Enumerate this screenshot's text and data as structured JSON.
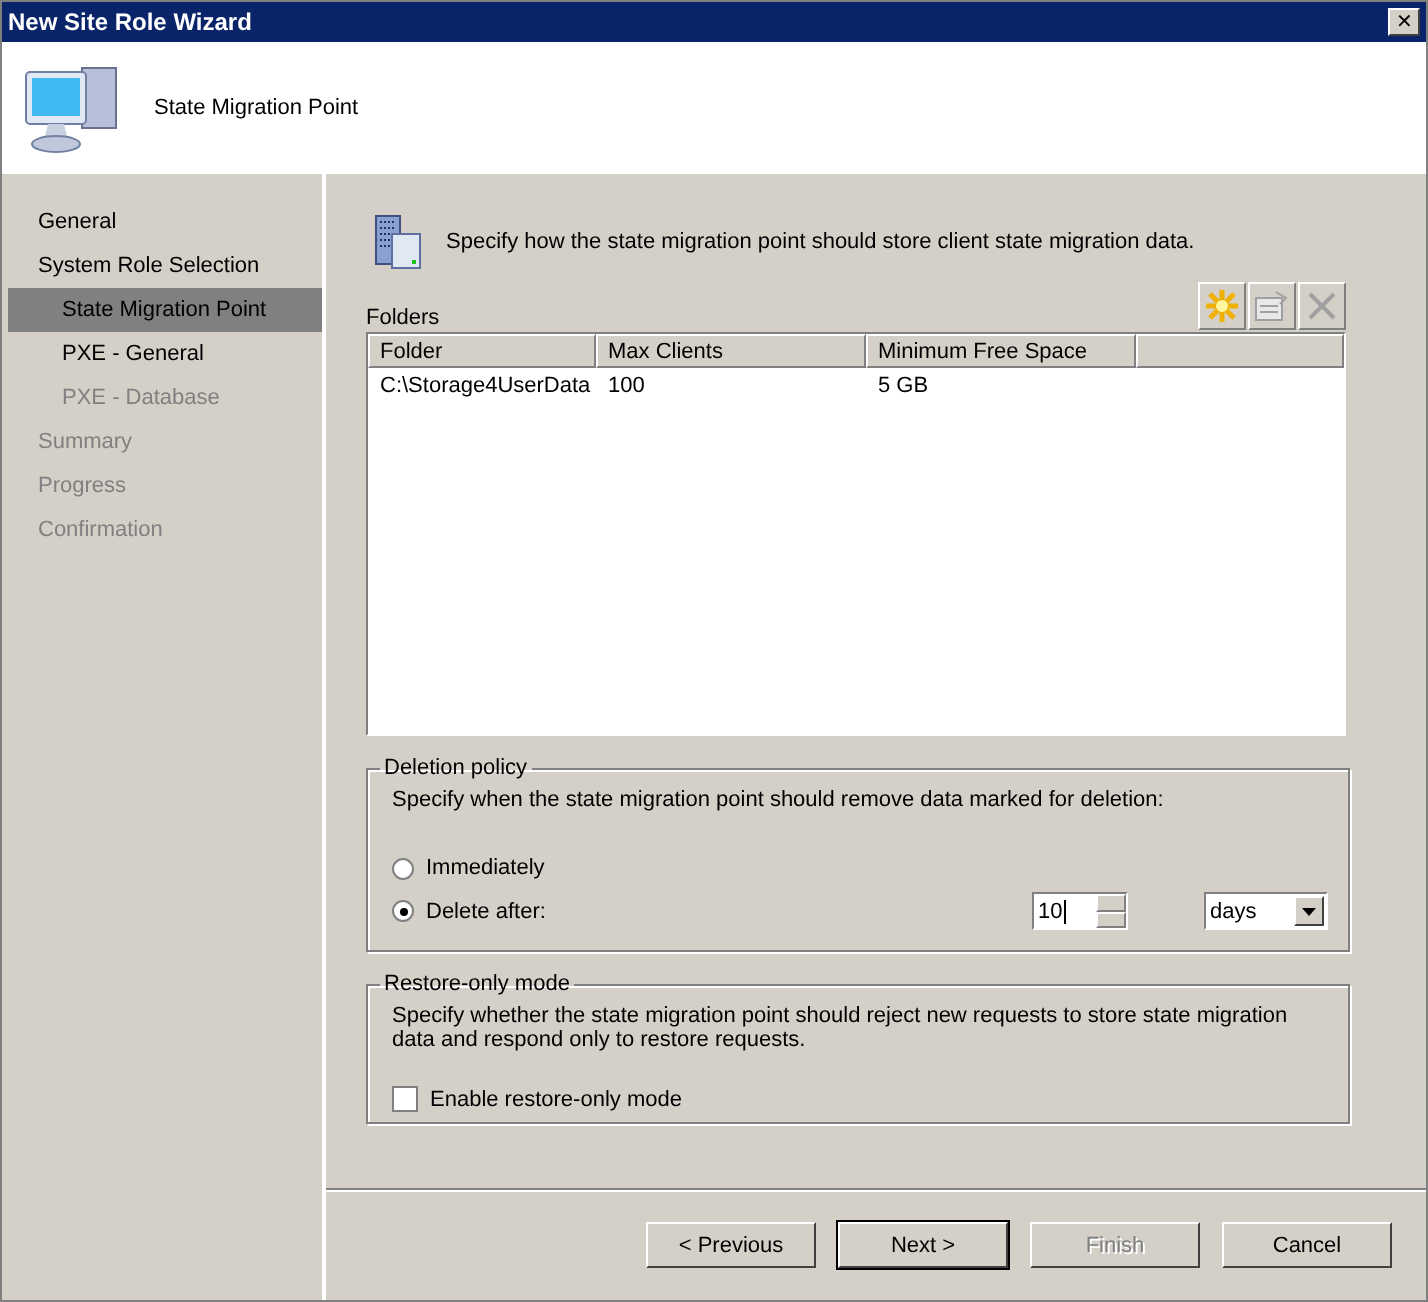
{
  "window": {
    "title": "New Site Role Wizard",
    "close": "✕"
  },
  "header": {
    "title": "State Migration Point"
  },
  "nav": [
    {
      "label": "General",
      "selected": false,
      "disabled": false
    },
    {
      "label": "System Role Selection",
      "selected": false,
      "disabled": false,
      "children": [
        {
          "label": "State Migration Point",
          "selected": true,
          "disabled": false
        },
        {
          "label": "PXE - General",
          "selected": false,
          "disabled": false
        },
        {
          "label": "PXE - Database",
          "selected": false,
          "disabled": true
        }
      ]
    },
    {
      "label": "Summary",
      "selected": false,
      "disabled": true
    },
    {
      "label": "Progress",
      "selected": false,
      "disabled": true
    },
    {
      "label": "Confirmation",
      "selected": false,
      "disabled": true
    }
  ],
  "intro": "Specify how the state migration point should store client state migration data.",
  "folders": {
    "label": "Folders",
    "toolbar": [
      {
        "kind": "new",
        "disabled": false
      },
      {
        "kind": "properties",
        "disabled": true
      },
      {
        "kind": "delete",
        "disabled": true
      }
    ],
    "columns": [
      "Folder",
      "Max Clients",
      "Minimum Free Space"
    ],
    "rows": [
      [
        "C:\\Storage4UserData",
        "100",
        "5 GB"
      ]
    ]
  },
  "deletion_policy": {
    "title": "Deletion policy",
    "description": "Specify when the state migration point should remove data marked for deletion:",
    "options": [
      {
        "label": "Immediately",
        "selected": false
      },
      {
        "label": "Delete after:",
        "selected": true
      }
    ],
    "amount": "10",
    "unit": "days"
  },
  "restore_only": {
    "title": "Restore-only mode",
    "description": "Specify whether the state migration point should reject new requests to store state migration data and respond only to restore requests.",
    "checkbox": {
      "label": "Enable restore-only mode",
      "checked": false
    }
  },
  "buttons": [
    {
      "label": "< Previous",
      "default": false,
      "disabled": false
    },
    {
      "label": "Next >",
      "default": true,
      "disabled": false
    },
    {
      "label": "Finish",
      "default": false,
      "disabled": true
    },
    {
      "label": "Cancel",
      "default": false,
      "disabled": false
    }
  ]
}
